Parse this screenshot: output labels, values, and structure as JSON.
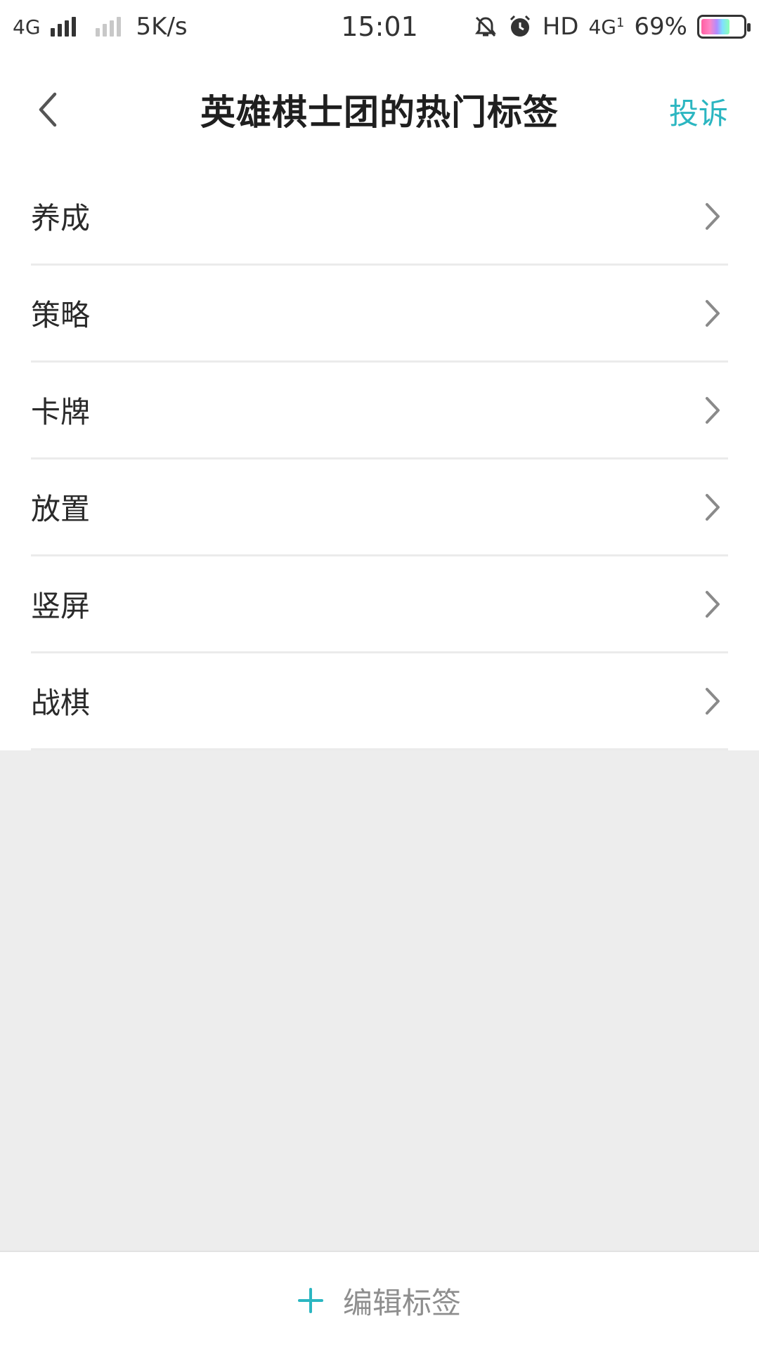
{
  "status_bar": {
    "network_type": "4G",
    "speed": "5K/s",
    "time": "15:01",
    "hd_label": "HD",
    "network_right": "4G",
    "network_right_sub": "1",
    "battery_percent": "69%",
    "battery_level": 0.69,
    "icons": [
      "signal-icon",
      "signal-secondary-icon",
      "mute-icon",
      "alarm-icon",
      "battery-icon"
    ]
  },
  "header": {
    "back_icon": "chevron-left-icon",
    "title": "英雄棋士团的热门标签",
    "report_label": "投诉",
    "accent_color": "#2bb6c1"
  },
  "tags": [
    {
      "label": "养成"
    },
    {
      "label": "策略"
    },
    {
      "label": "卡牌"
    },
    {
      "label": "放置"
    },
    {
      "label": "竖屏"
    },
    {
      "label": "战棋"
    }
  ],
  "bottom_bar": {
    "icon": "plus-icon",
    "label": "编辑标签"
  }
}
